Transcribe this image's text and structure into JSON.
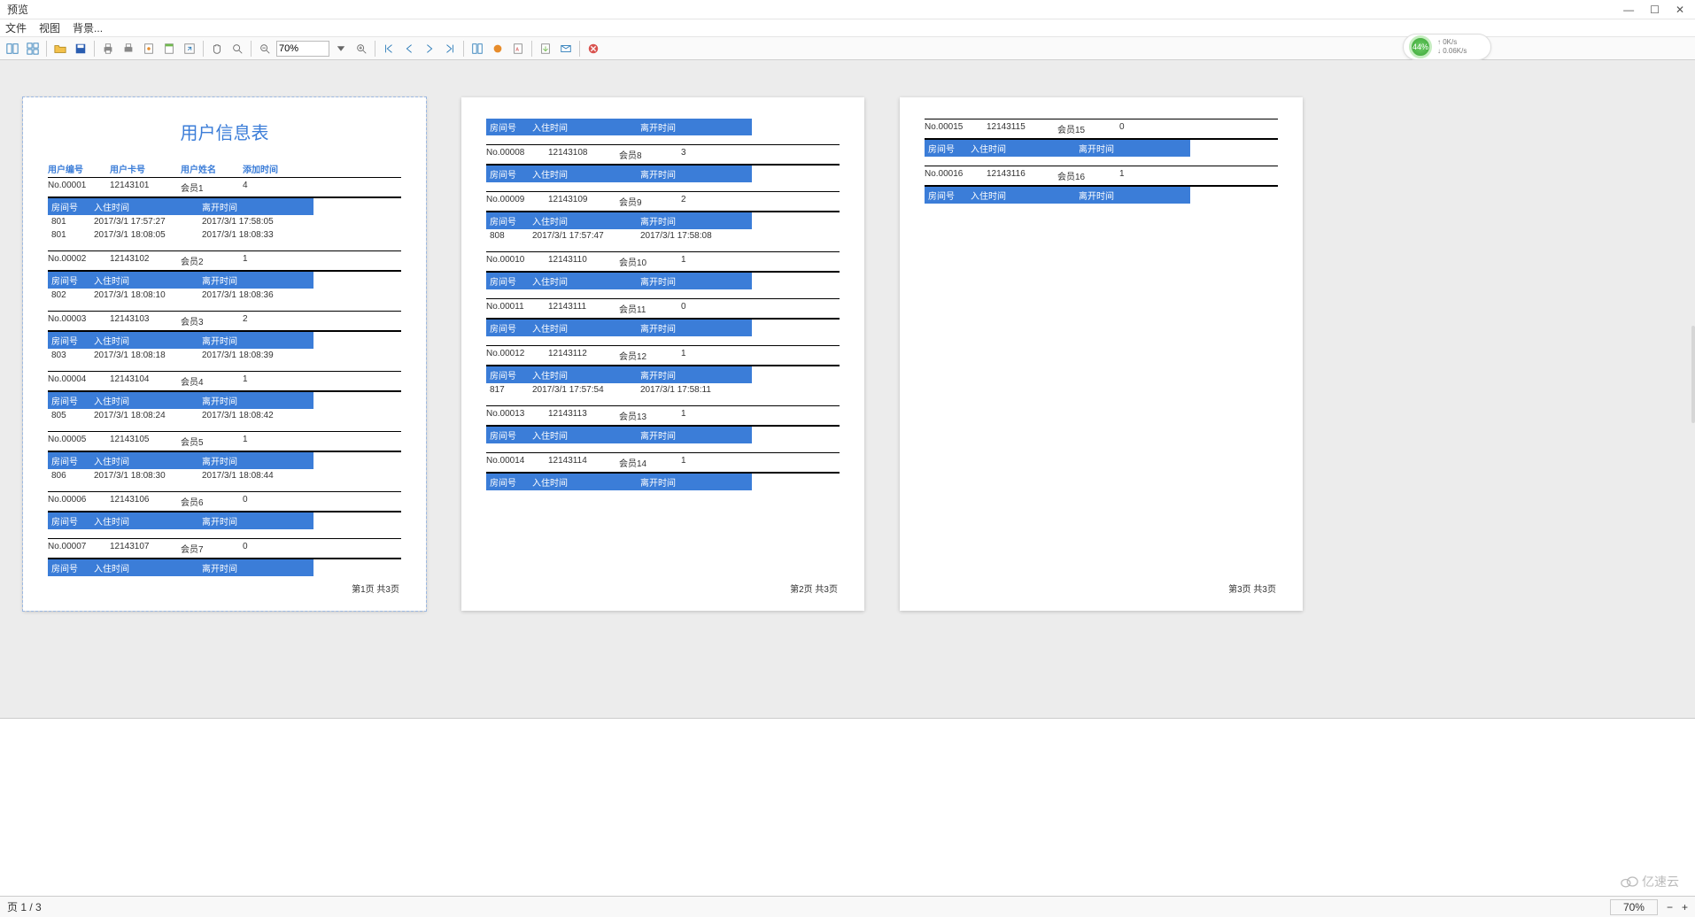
{
  "window": {
    "title": "预览"
  },
  "menu": {
    "file": "文件",
    "view": "视图",
    "bg": "背景..."
  },
  "toolbar": {
    "zoom_value": "70%"
  },
  "net": {
    "pct": "44%",
    "up": "0K/s",
    "down": "0.06K/s"
  },
  "doc": {
    "title": "用户信息表",
    "head": {
      "no": "用户编号",
      "card": "用户卡号",
      "name": "用户姓名",
      "add": "添加时间"
    },
    "sub_head": {
      "room": "房间号",
      "in": "入住时间",
      "out": "离开时间"
    }
  },
  "page1": {
    "blocks": [
      {
        "no": "No.00001",
        "card": "12143101",
        "name": "会员1",
        "cnt": "4",
        "rows": [
          {
            "room": "801",
            "in": "2017/3/1 17:57:27",
            "out": "2017/3/1 17:58:05"
          },
          {
            "room": "801",
            "in": "2017/3/1 18:08:05",
            "out": "2017/3/1 18:08:33"
          }
        ]
      },
      {
        "no": "No.00002",
        "card": "12143102",
        "name": "会员2",
        "cnt": "1",
        "rows": [
          {
            "room": "802",
            "in": "2017/3/1 18:08:10",
            "out": "2017/3/1 18:08:36"
          }
        ]
      },
      {
        "no": "No.00003",
        "card": "12143103",
        "name": "会员3",
        "cnt": "2",
        "rows": [
          {
            "room": "803",
            "in": "2017/3/1 18:08:18",
            "out": "2017/3/1 18:08:39"
          }
        ]
      },
      {
        "no": "No.00004",
        "card": "12143104",
        "name": "会员4",
        "cnt": "1",
        "rows": [
          {
            "room": "805",
            "in": "2017/3/1 18:08:24",
            "out": "2017/3/1 18:08:42"
          }
        ]
      },
      {
        "no": "No.00005",
        "card": "12143105",
        "name": "会员5",
        "cnt": "1",
        "rows": [
          {
            "room": "806",
            "in": "2017/3/1 18:08:30",
            "out": "2017/3/1 18:08:44"
          }
        ]
      },
      {
        "no": "No.00006",
        "card": "12143106",
        "name": "会员6",
        "cnt": "0",
        "rows": []
      },
      {
        "no": "No.00007",
        "card": "12143107",
        "name": "会员7",
        "cnt": "0",
        "rows": []
      }
    ],
    "footer": "第1页  共3页"
  },
  "page2": {
    "blocks": [
      {
        "nohead": true,
        "rows": []
      },
      {
        "no": "No.00008",
        "card": "12143108",
        "name": "会员8",
        "cnt": "3",
        "rows": []
      },
      {
        "no": "No.00009",
        "card": "12143109",
        "name": "会员9",
        "cnt": "2",
        "rows": [
          {
            "room": "808",
            "in": "2017/3/1 17:57:47",
            "out": "2017/3/1 17:58:08"
          }
        ]
      },
      {
        "no": "No.00010",
        "card": "12143110",
        "name": "会员10",
        "cnt": "1",
        "rows": []
      },
      {
        "no": "No.00011",
        "card": "12143111",
        "name": "会员11",
        "cnt": "0",
        "rows": []
      },
      {
        "no": "No.00012",
        "card": "12143112",
        "name": "会员12",
        "cnt": "1",
        "rows": [
          {
            "room": "817",
            "in": "2017/3/1 17:57:54",
            "out": "2017/3/1 17:58:11"
          }
        ]
      },
      {
        "no": "No.00013",
        "card": "12143113",
        "name": "会员13",
        "cnt": "1",
        "rows": []
      },
      {
        "no": "No.00014",
        "card": "12143114",
        "name": "会员14",
        "cnt": "1",
        "rows": []
      }
    ],
    "footer": "第2页  共3页"
  },
  "page3": {
    "blocks": [
      {
        "no": "No.00015",
        "card": "12143115",
        "name": "会员15",
        "cnt": "0",
        "rows": []
      },
      {
        "no": "No.00016",
        "card": "12143116",
        "name": "会员16",
        "cnt": "1",
        "rows": []
      }
    ],
    "footer": "第3页  共3页"
  },
  "status": {
    "page": "页 1 / 3",
    "zoom": "70%"
  },
  "watermark": "亿速云"
}
